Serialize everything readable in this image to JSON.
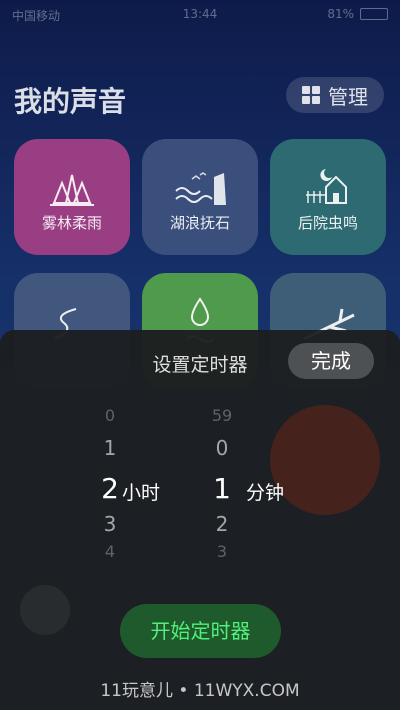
{
  "status_bar": {
    "carrier": "中国移动",
    "time": "13:44",
    "battery_pct": "81%"
  },
  "header": {
    "title": "我的声音",
    "manage_label": "管理"
  },
  "sounds": [
    {
      "label": "雾林柔雨",
      "icon": "forest-rain-icon",
      "color": "#9a3e84"
    },
    {
      "label": "湖浪抚石",
      "icon": "lake-wave-icon",
      "color": "#3b4f7c"
    },
    {
      "label": "后院虫鸣",
      "icon": "backyard-house-icon",
      "color": "#2d6a72"
    },
    {
      "label": "",
      "icon": "river-icon",
      "color": "#41577d"
    },
    {
      "label": "",
      "icon": "water-drop-icon",
      "color": "#4f9a4c"
    },
    {
      "label": "",
      "icon": "branch-icon",
      "color": "#3e5e78"
    }
  ],
  "timer_sheet": {
    "title": "设置定时器",
    "done_label": "完成",
    "hours": {
      "far_above": "0",
      "above": "1",
      "selected": "2",
      "below": "3",
      "far_below": "4",
      "unit": "小时"
    },
    "minutes": {
      "far_above": "59",
      "above": "0",
      "selected": "1",
      "below": "2",
      "far_below": "3",
      "unit": "分钟"
    },
    "start_label": "开始定时器"
  },
  "watermark": "11玩意儿 • 11WYX.COM"
}
